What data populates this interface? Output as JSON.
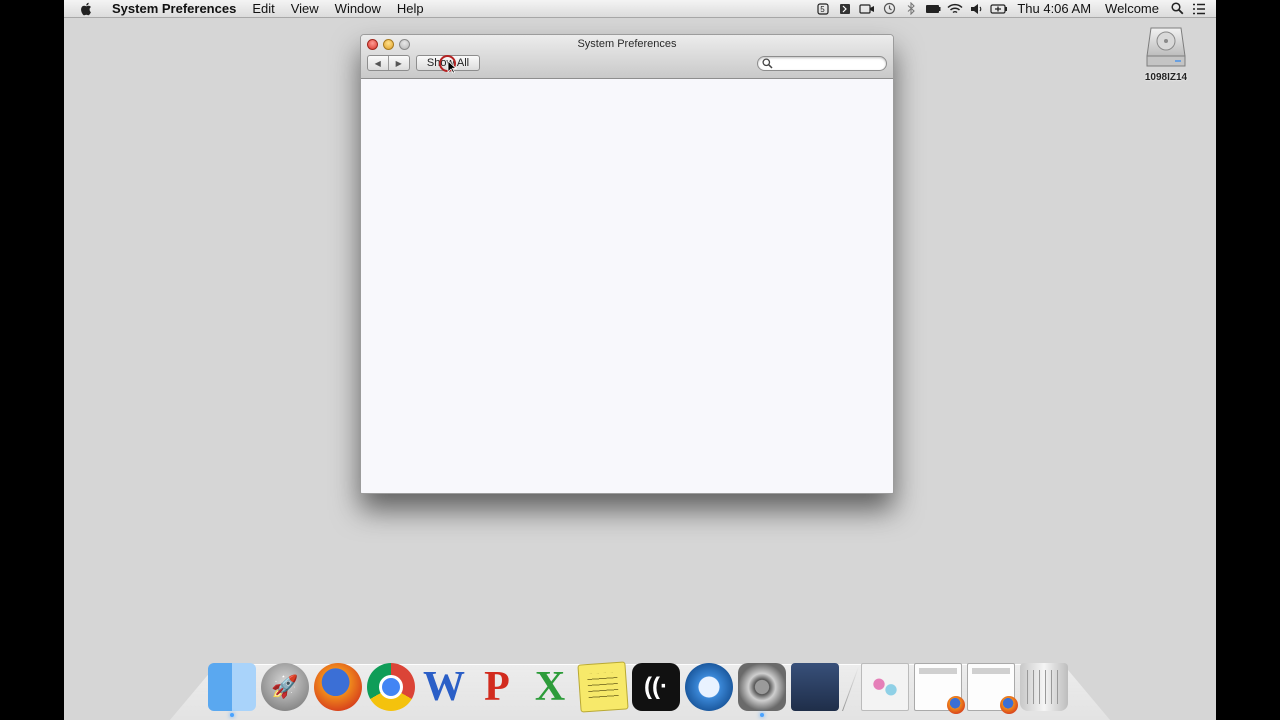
{
  "menubar": {
    "app_name": "System Preferences",
    "menus": [
      "Edit",
      "View",
      "Window",
      "Help"
    ],
    "clock": "Thu 4:06 AM",
    "user": "Welcome"
  },
  "desktop": {
    "disk_label": "1098IZ14"
  },
  "window": {
    "title": "System Preferences",
    "show_all_label": "Show All",
    "search_placeholder": "",
    "back_glyph": "◀",
    "forward_glyph": "▶"
  },
  "dock": {
    "items": [
      "Finder",
      "Launchpad",
      "Firefox",
      "Google Chrome",
      "Word",
      "PowerPoint",
      "Excel",
      "Stickies",
      "Audio",
      "Safari",
      "System Preferences",
      "Photo Booth",
      "Document",
      "Window",
      "Window",
      "Trash"
    ]
  }
}
